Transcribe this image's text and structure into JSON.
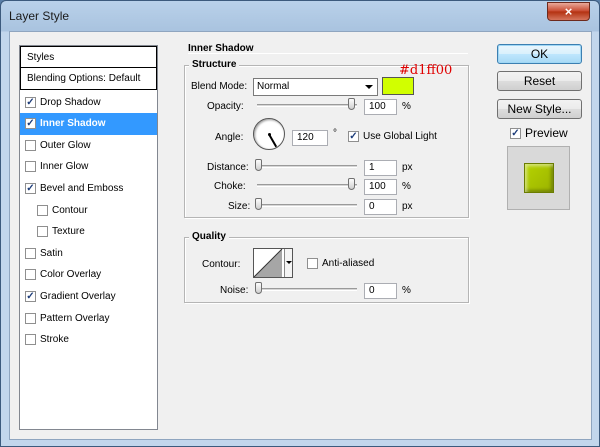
{
  "window": {
    "title": "Layer Style",
    "close_symbol": "×"
  },
  "sidebar": {
    "header": "Styles",
    "blending_options": "Blending Options: Default",
    "items": [
      {
        "label": "Drop Shadow",
        "checked": true,
        "selected": false,
        "indent": false
      },
      {
        "label": "Inner Shadow",
        "checked": true,
        "selected": true,
        "indent": false
      },
      {
        "label": "Outer Glow",
        "checked": false,
        "selected": false,
        "indent": false
      },
      {
        "label": "Inner Glow",
        "checked": false,
        "selected": false,
        "indent": false
      },
      {
        "label": "Bevel and Emboss",
        "checked": true,
        "selected": false,
        "indent": false
      },
      {
        "label": "Contour",
        "checked": false,
        "selected": false,
        "indent": true
      },
      {
        "label": "Texture",
        "checked": false,
        "selected": false,
        "indent": true
      },
      {
        "label": "Satin",
        "checked": false,
        "selected": false,
        "indent": false
      },
      {
        "label": "Color Overlay",
        "checked": false,
        "selected": false,
        "indent": false
      },
      {
        "label": "Gradient Overlay",
        "checked": true,
        "selected": false,
        "indent": false
      },
      {
        "label": "Pattern Overlay",
        "checked": false,
        "selected": false,
        "indent": false
      },
      {
        "label": "Stroke",
        "checked": false,
        "selected": false,
        "indent": false
      }
    ]
  },
  "panel": {
    "title": "Inner Shadow",
    "structure": {
      "label": "Structure",
      "blend_mode_label": "Blend Mode:",
      "blend_mode_value": "Normal",
      "color_swatch": "#d1ff00",
      "color_annotation": "#d1ff00",
      "opacity_label": "Opacity:",
      "opacity_value": "100",
      "opacity_unit": "%",
      "angle_label": "Angle:",
      "angle_value": "120",
      "angle_unit": "°",
      "global_light_label": "Use Global Light",
      "global_light_checked": true,
      "distance_label": "Distance:",
      "distance_value": "1",
      "distance_unit": "px",
      "choke_label": "Choke:",
      "choke_value": "100",
      "choke_unit": "%",
      "size_label": "Size:",
      "size_value": "0",
      "size_unit": "px"
    },
    "quality": {
      "label": "Quality",
      "contour_label": "Contour:",
      "anti_aliased_label": "Anti-aliased",
      "anti_aliased_checked": false,
      "noise_label": "Noise:",
      "noise_value": "0",
      "noise_unit": "%"
    }
  },
  "buttons": {
    "ok": "OK",
    "reset": "Reset",
    "new_style": "New Style..."
  },
  "preview": {
    "label": "Preview",
    "checked": true,
    "swatch_color": "#b6d300"
  },
  "colors": {
    "selection": "#3399ff",
    "annotation_red": "#e00000"
  }
}
